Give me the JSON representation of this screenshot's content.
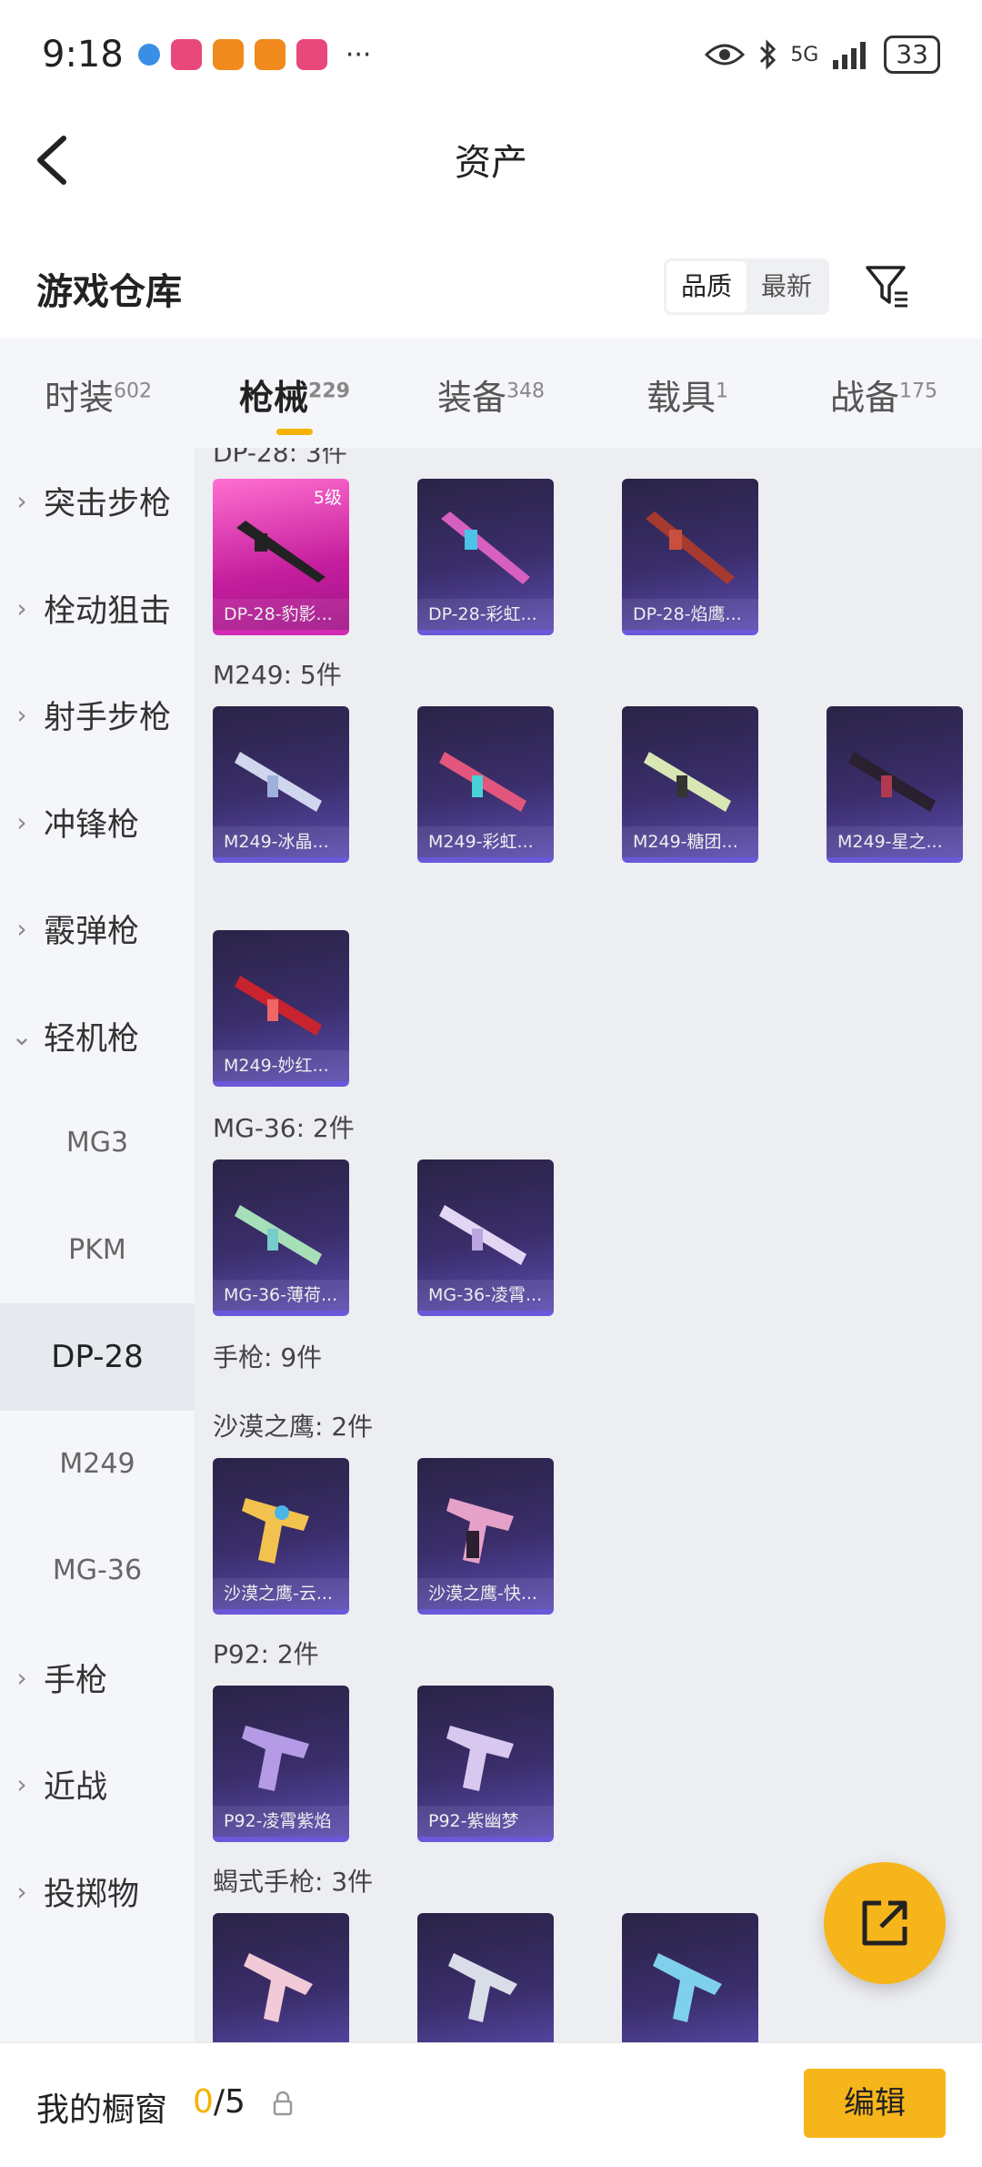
{
  "status_bar": {
    "time": "9:18",
    "battery": "33",
    "network": "5G"
  },
  "header": {
    "title": "资产"
  },
  "warehouse": {
    "title": "游戏仓库",
    "sort_quality": "品质",
    "sort_newest": "最新"
  },
  "tabs": [
    {
      "label": "时装",
      "count": "602"
    },
    {
      "label": "枪械",
      "count": "229"
    },
    {
      "label": "装备",
      "count": "348"
    },
    {
      "label": "载具",
      "count": "1"
    },
    {
      "label": "战备",
      "count": "175"
    }
  ],
  "sidebar": {
    "items": [
      "突击步枪",
      "栓动狙击",
      "射手步枪",
      "冲锋枪",
      "霰弹枪",
      "轻机枪"
    ],
    "sub_items": [
      "MG3",
      "PKM",
      "DP-28",
      "M249",
      "MG-36"
    ],
    "items_after": [
      "手枪",
      "近战",
      "投掷物"
    ]
  },
  "content": {
    "partial_label": "DP-28: 3件",
    "dp28_cards": [
      "DP-28-豹影...",
      "DP-28-彩虹...",
      "DP-28-焰鹰..."
    ],
    "dp28_level": "5级",
    "m249_label": "M249: 5件",
    "m249_cards": [
      "M249-冰晶...",
      "M249-彩虹...",
      "M249-糖团...",
      "M249-星之...",
      "M249-妙红..."
    ],
    "mg36_label": "MG-36: 2件",
    "mg36_cards": [
      "MG-36-薄荷...",
      "MG-36-凌霄..."
    ],
    "pistol_label": "手枪: 9件",
    "deagle_label": "沙漠之鹰: 2件",
    "deagle_cards": [
      "沙漠之鹰-云...",
      "沙漠之鹰-快..."
    ],
    "p92_label": "P92: 2件",
    "p92_cards": [
      "P92-凌霄紫焰",
      "P92-紫幽梦"
    ],
    "scorpion_label": "蝎式手枪: 3件"
  },
  "bottom_bar": {
    "label": "我的橱窗",
    "current": "0",
    "total": "/5",
    "edit": "编辑"
  },
  "colors": {
    "accent": "#f7b51c",
    "card_dark": "#2a2346",
    "card_pink": "#c51e9d"
  }
}
